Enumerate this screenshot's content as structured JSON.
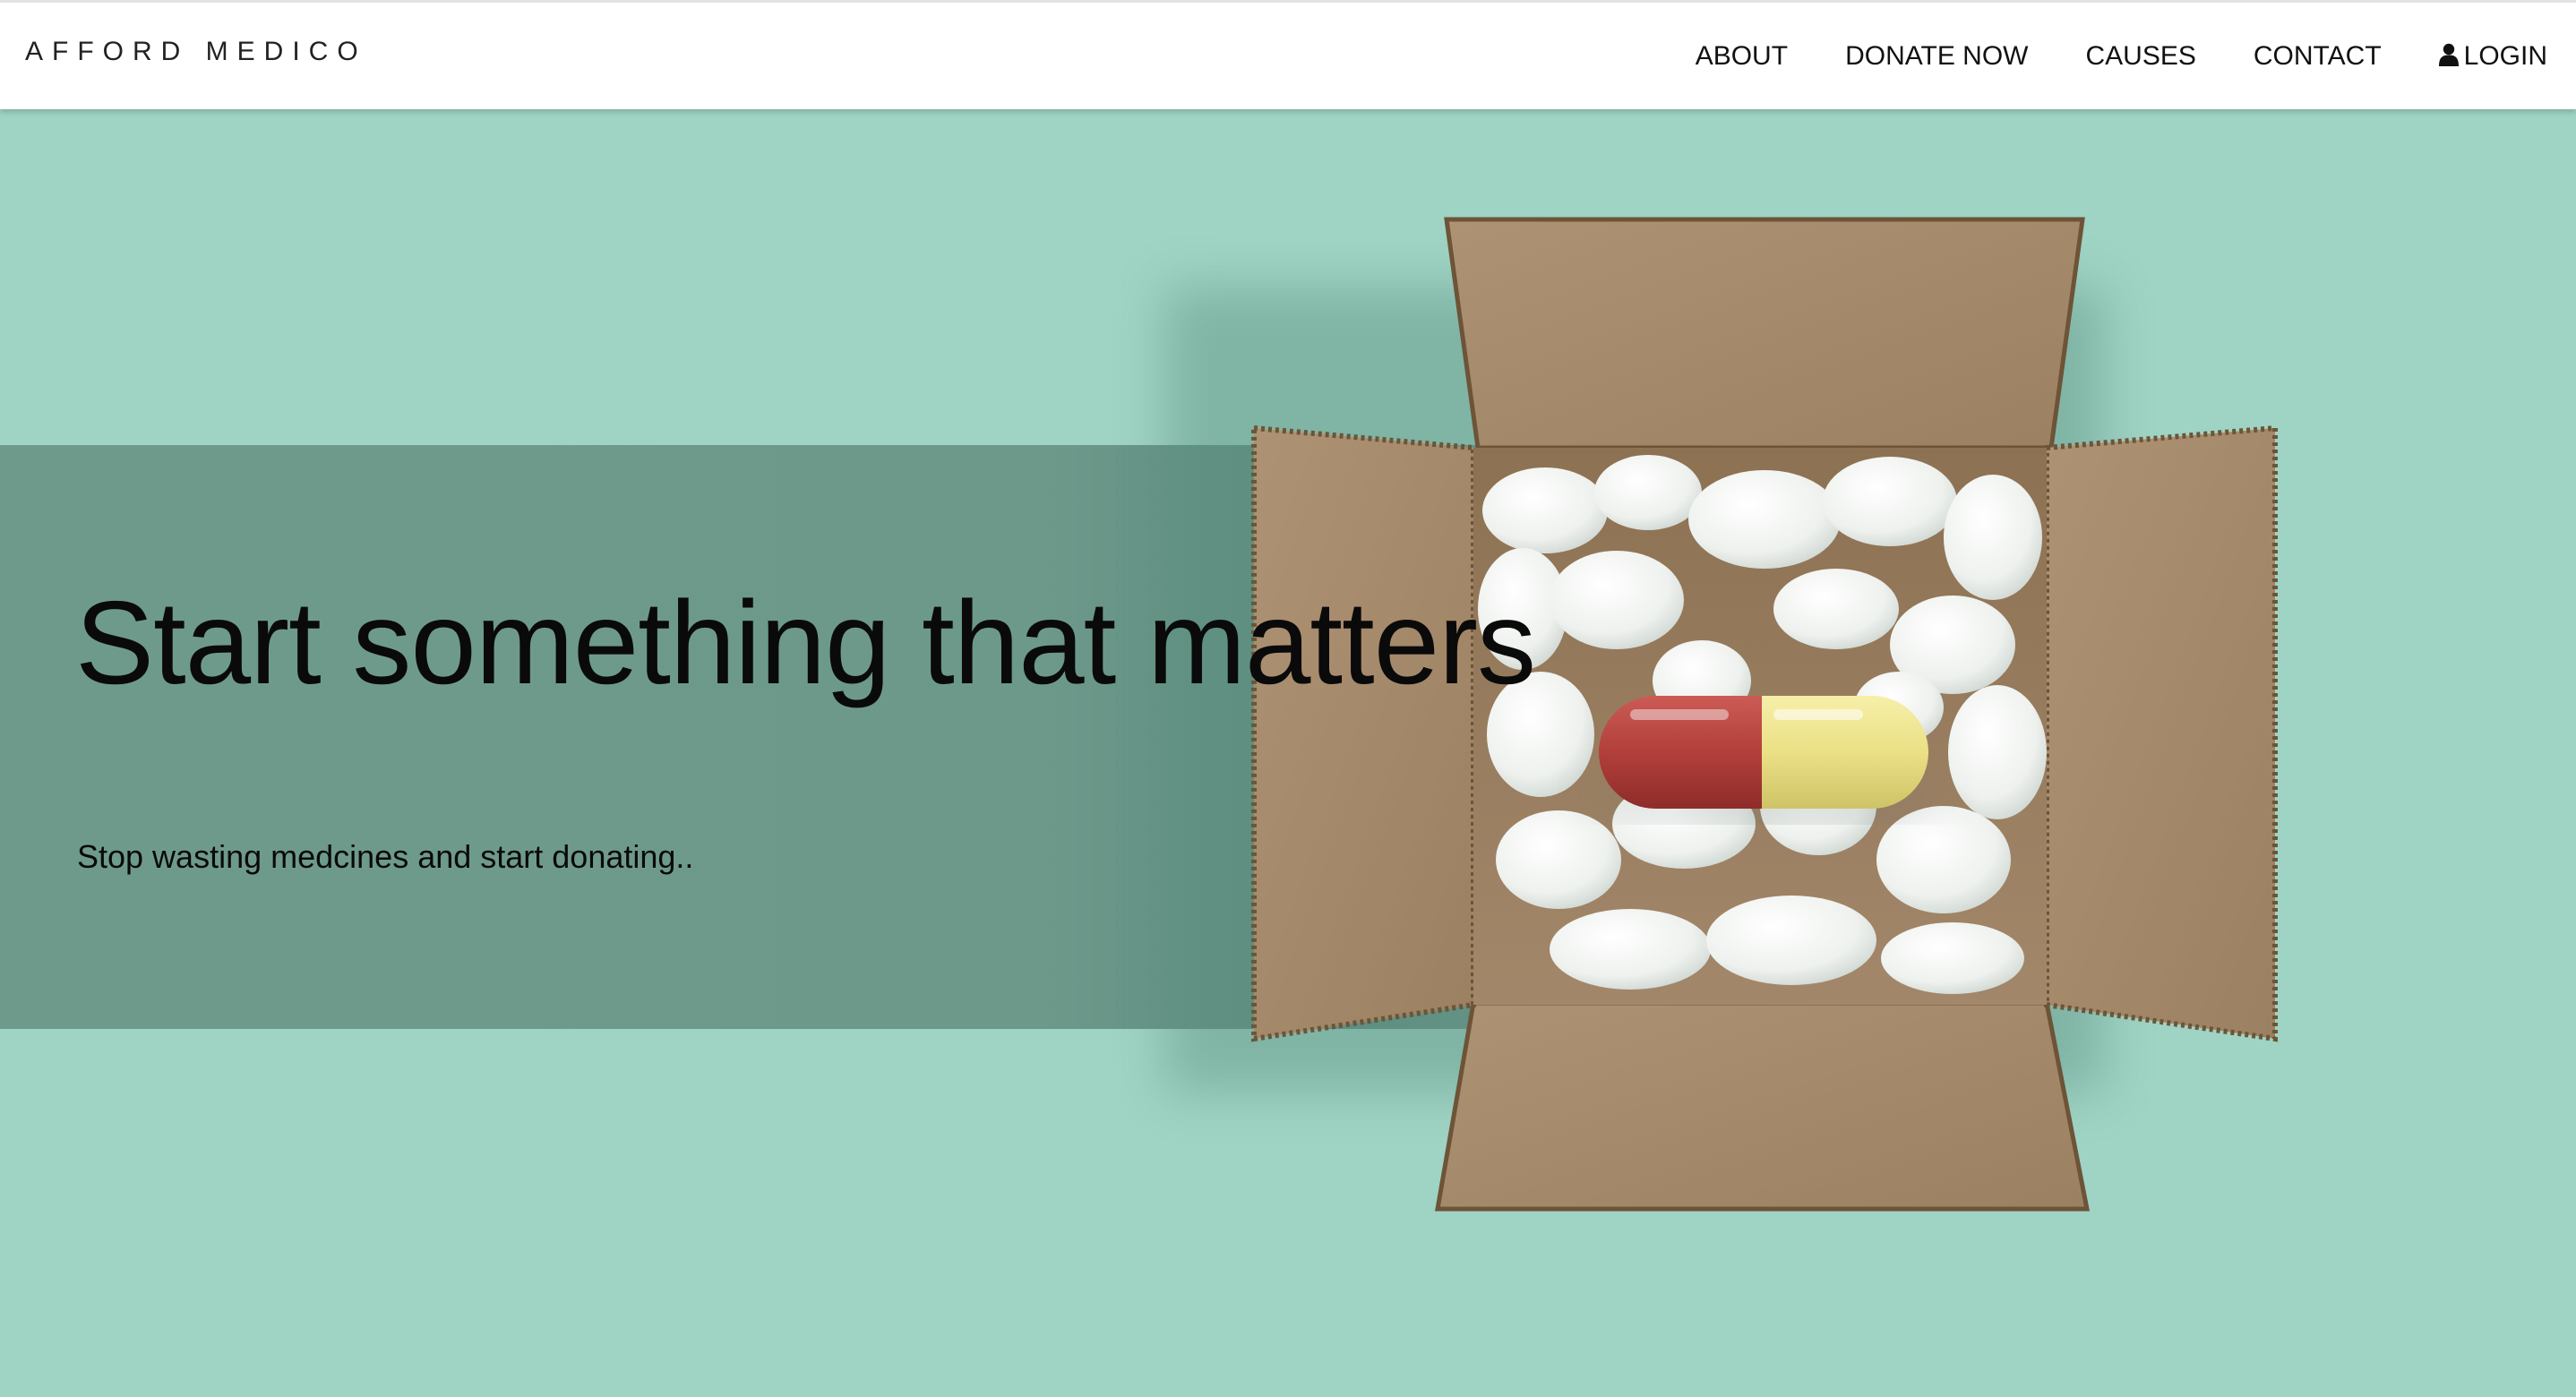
{
  "header": {
    "brand": "AFFORD MEDICO",
    "nav": [
      {
        "label": "ABOUT"
      },
      {
        "label": "DONATE NOW"
      },
      {
        "label": "CAUSES"
      },
      {
        "label": "CONTACT"
      },
      {
        "label": "LOGIN",
        "icon": "user-icon"
      }
    ]
  },
  "hero": {
    "title": "Start something that matters",
    "subtitle": "Stop wasting medcines and start donating..",
    "image": "cardboard-box-with-capsule-pill"
  },
  "colors": {
    "background": "#9fd3c3",
    "band": "#6e9a8c",
    "navbar": "#ffffff",
    "text": "#0a0a0a",
    "pill_red": "#b8423d",
    "pill_yellow": "#ece38a",
    "cardboard": "#a88b6c"
  }
}
